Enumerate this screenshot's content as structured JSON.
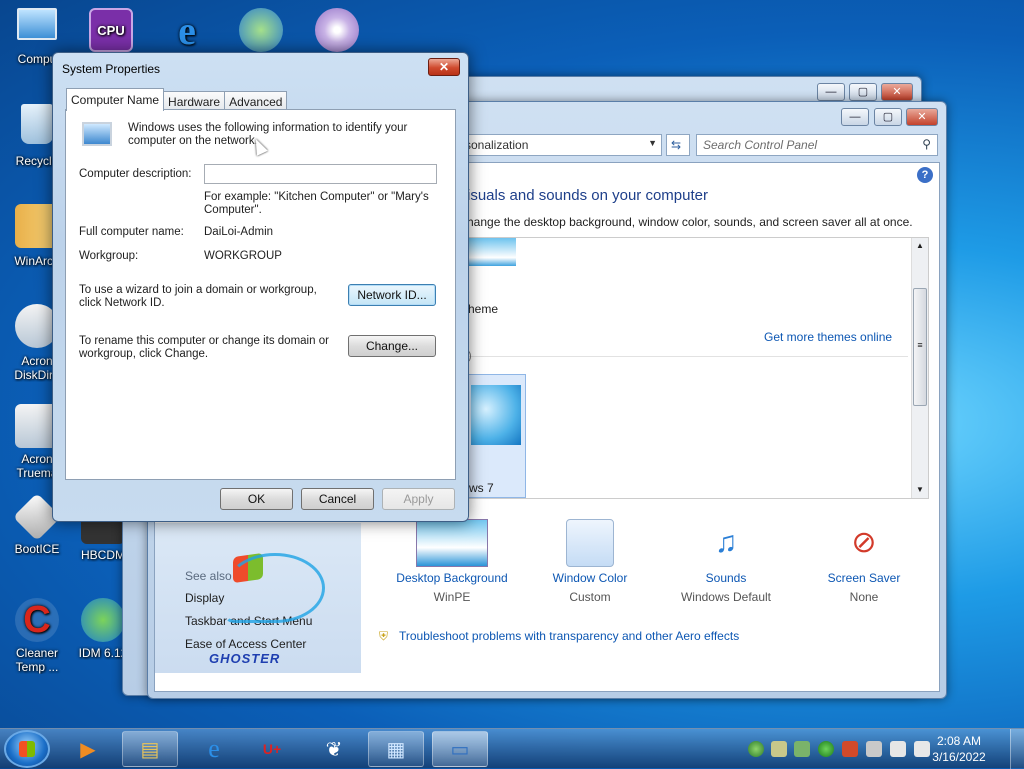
{
  "desktop": {
    "icons": [
      {
        "label": "Compu",
        "icon": "computer-icon"
      },
      {
        "label": "Recycle",
        "icon": "recycle-bin-icon"
      },
      {
        "label": "WinArch",
        "icon": "winrar-icon"
      },
      {
        "label": "Acron",
        "icon": "acronis-icon"
      },
      {
        "label": "DiskDire",
        "icon": "acronis-icon"
      },
      {
        "label": "Acron",
        "icon": "acronis-icon"
      },
      {
        "label": "Truema",
        "icon": "acronis-icon"
      },
      {
        "label": "BootICE",
        "icon": "bootice-icon"
      },
      {
        "label": "HBCDM",
        "icon": "hbcd-icon"
      },
      {
        "label": "Cleaner",
        "icon": "ccleaner-icon"
      },
      {
        "label": "Temp ...",
        "icon": "ccleaner-icon"
      },
      {
        "label": "IDM 6.12",
        "icon": "idm-icon"
      },
      {
        "label": "CPU-Z",
        "icon": "cpuz-icon"
      }
    ]
  },
  "control_panel": {
    "address": "rsonalization",
    "search_placeholder": "Search Control Panel",
    "heading": "isuals and sounds on your computer",
    "subheading": "hange the desktop background, window color, sounds, and screen saver all at once.",
    "theme_partial": "heme",
    "get_more_link": "Get more themes online",
    "paren_partial": ")",
    "win7_partial": "ws 7",
    "see_also": "See also",
    "left_links": [
      "Display",
      "Taskbar and Start Menu",
      "Ease of Access Center"
    ],
    "bottom_items": [
      {
        "title": "Desktop Background",
        "value": "WinPE"
      },
      {
        "title": "Window Color",
        "value": "Custom"
      },
      {
        "title": "Sounds",
        "value": "Windows Default"
      },
      {
        "title": "Screen Saver",
        "value": "None"
      }
    ],
    "troubleshoot_link": "Troubleshoot problems with transparency and other Aero effects",
    "ghoster_logo": "GHOSTER"
  },
  "dialog": {
    "title": "System Properties",
    "close": "x",
    "tabs": [
      "Computer Name",
      "Hardware",
      "Advanced"
    ],
    "intro": "Windows uses the following information to identify your computer on the network.",
    "description_label": "Computer description:",
    "description_value": "",
    "example": "For example: \"Kitchen Computer\" or \"Mary's Computer\".",
    "full_name_label": "Full computer name:",
    "full_name_value": "DaiLoi-Admin",
    "workgroup_label": "Workgroup:",
    "workgroup_value": "WORKGROUP",
    "wizard_text": "To use a wizard to join a domain or workgroup, click Network ID.",
    "network_id_button": "Network ID...",
    "rename_text": "To rename this computer or change its domain or workgroup, click Change.",
    "change_button": "Change...",
    "ok_button": "OK",
    "cancel_button": "Cancel",
    "apply_button": "Apply"
  },
  "taskbar": {
    "time": "2:08 AM",
    "date": "3/16/2022"
  }
}
